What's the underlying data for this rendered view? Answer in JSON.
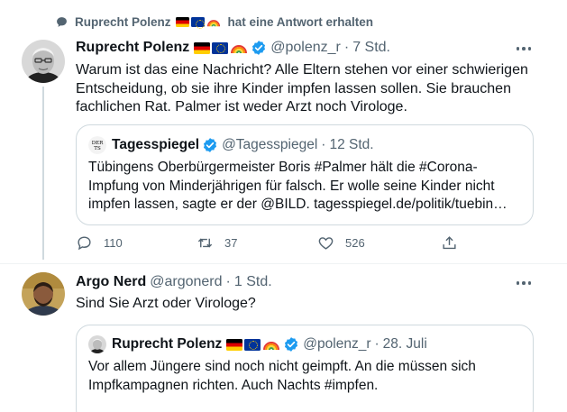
{
  "context": {
    "name": "Ruprecht Polenz",
    "text": "hat eine Antwort erhalten"
  },
  "tweet1": {
    "name": "Ruprecht Polenz",
    "handle": "@polenz_r",
    "time": "7 Std.",
    "lines": [
      "Warum ist das eine Nachricht? Alle Eltern stehen vor einer schwierigen",
      "Entscheidung, ob sie ihre Kinder impfen lassen sollen. Sie brauchen",
      "fachlichen Rat. Palmer ist weder Arzt noch Virologe."
    ],
    "quote": {
      "name": "Tagesspiegel",
      "handle": "@Tagesspiegel",
      "time": "12 Std.",
      "lines": [
        "Tübingens Oberbürgermeister Boris #Palmer hält die #Corona-",
        "Impfung von Minderjährigen für falsch. Er wolle seine Kinder nicht",
        "impfen lassen, sagte er der @BILD. tagesspiegel.de/politik/tuebin…"
      ]
    },
    "actions": {
      "replies": "110",
      "retweets": "37",
      "likes": "526"
    }
  },
  "tweet2": {
    "name": "Argo Nerd",
    "handle": "@argonerd",
    "time": "1 Std.",
    "lines": [
      "Sind Sie Arzt oder Virologe?"
    ],
    "quote": {
      "name": "Ruprecht Polenz",
      "handle": "@polenz_r",
      "time": "28. Juli",
      "lines": [
        "Vor allem Jüngere sind noch nicht geimpft. An die müssen sich",
        "Impfkampagnen richten. Auch Nachts #impfen."
      ]
    }
  },
  "colors": {
    "accent": "#1d9bf0",
    "secondary_text": "#536471",
    "border": "#cfd9de"
  }
}
